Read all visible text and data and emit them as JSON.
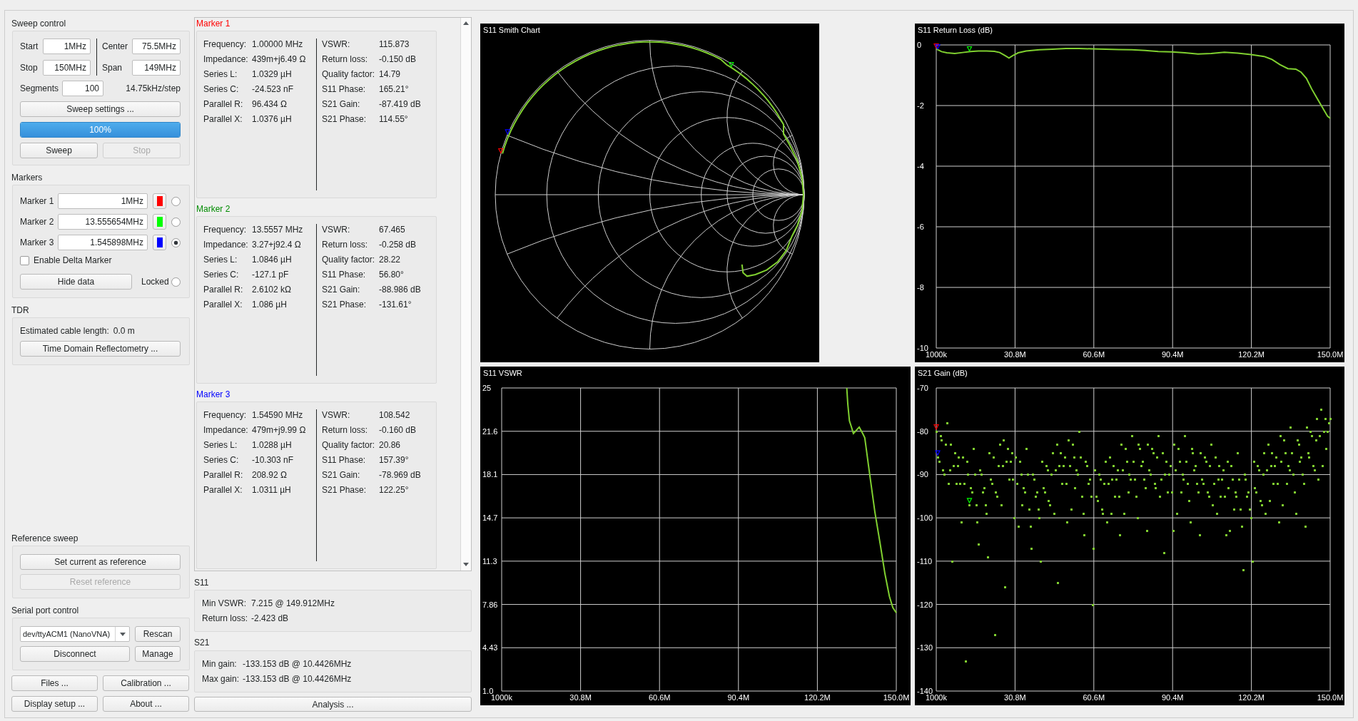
{
  "sweep_control": {
    "title": "Sweep control",
    "fields": [
      {
        "label": "Start",
        "value": "1MHz"
      },
      {
        "label": "Center",
        "value": "75.5MHz"
      },
      {
        "label": "Stop",
        "value": "150MHz"
      },
      {
        "label": "Span",
        "value": "149MHz"
      }
    ],
    "segments": {
      "label": "Segments",
      "value": "100"
    },
    "step": "14.75kHz/step",
    "settings_button": "Sweep settings ...",
    "progress": {
      "label": "100%",
      "level": 1
    },
    "buttons": [
      {
        "label": "Sweep",
        "disabled": false
      },
      {
        "label": "Stop",
        "disabled": true
      }
    ]
  },
  "markers": {
    "title": "Markers",
    "items": [
      {
        "label": "Marker 1",
        "value": "1MHz",
        "color": "#ff0000",
        "selected": false
      },
      {
        "label": "Marker 2",
        "value": "13.555654MHz",
        "color": "#00ff00",
        "selected": false
      },
      {
        "label": "Marker 3",
        "value": "1.545898MHz",
        "color": "#0000ff",
        "selected": true
      }
    ],
    "delta": {
      "label": "Enable Delta Marker",
      "checked": false
    },
    "hide_button": "Hide data",
    "locked": {
      "label": "Locked",
      "checked": false
    }
  },
  "tdr": {
    "title": "TDR",
    "estimate_label": "Estimated cable length:",
    "estimate_value": "0.0 m",
    "button": "Time Domain Reflectometry ..."
  },
  "reference_sweep": {
    "title": "Reference sweep",
    "buttons": [
      {
        "label": "Set current as reference",
        "disabled": false
      },
      {
        "label": "Reset reference",
        "disabled": true
      }
    ]
  },
  "serial_port": {
    "title": "Serial port control",
    "port": "dev/ttyACM1 (NanoVNA)",
    "buttons": [
      "Rescan",
      "Disconnect",
      "Manage"
    ]
  },
  "bottom_buttons": [
    "Files ...",
    "Calibration ...",
    "Display setup ...",
    "About ..."
  ],
  "marker_data": [
    {
      "title": "Marker 1",
      "left": [
        {
          "label": "Frequency:",
          "value": "1.00000 MHz"
        },
        {
          "label": "Impedance:",
          "value": "439m+j6.49 Ω"
        },
        {
          "label": "Series L:",
          "value": "1.0329 µH"
        },
        {
          "label": "Series C:",
          "value": "-24.523 nF"
        },
        {
          "label": "Parallel R:",
          "value": "96.434 Ω"
        },
        {
          "label": "Parallel X:",
          "value": "1.0376 µH"
        }
      ],
      "right": [
        {
          "label": "VSWR:",
          "value": "115.873"
        },
        {
          "label": "Return loss:",
          "value": "-0.150 dB"
        },
        {
          "label": "Quality factor:",
          "value": "14.79"
        },
        {
          "label": "S11 Phase:",
          "value": "165.21°"
        },
        {
          "label": "S21 Gain:",
          "value": "-87.419 dB"
        },
        {
          "label": "S21 Phase:",
          "value": "114.55°"
        }
      ]
    },
    {
      "title": "Marker 2",
      "left": [
        {
          "label": "Frequency:",
          "value": "13.5557 MHz"
        },
        {
          "label": "Impedance:",
          "value": "3.27+j92.4 Ω"
        },
        {
          "label": "Series L:",
          "value": "1.0846 µH"
        },
        {
          "label": "Series C:",
          "value": "-127.1 pF"
        },
        {
          "label": "Parallel R:",
          "value": "2.6102 kΩ"
        },
        {
          "label": "Parallel X:",
          "value": "1.086 µH"
        }
      ],
      "right": [
        {
          "label": "VSWR:",
          "value": "67.465"
        },
        {
          "label": "Return loss:",
          "value": "-0.258 dB"
        },
        {
          "label": "Quality factor:",
          "value": "28.22"
        },
        {
          "label": "S11 Phase:",
          "value": "56.80°"
        },
        {
          "label": "S21 Gain:",
          "value": "-88.986 dB"
        },
        {
          "label": "S21 Phase:",
          "value": "-131.61°"
        }
      ]
    },
    {
      "title": "Marker 3",
      "left": [
        {
          "label": "Frequency:",
          "value": "1.54590 MHz"
        },
        {
          "label": "Impedance:",
          "value": "479m+j9.99 Ω"
        },
        {
          "label": "Series L:",
          "value": "1.0288 µH"
        },
        {
          "label": "Series C:",
          "value": "-10.303 nF"
        },
        {
          "label": "Parallel R:",
          "value": "208.92 Ω"
        },
        {
          "label": "Parallel X:",
          "value": "1.0311 µH"
        }
      ],
      "right": [
        {
          "label": "VSWR:",
          "value": "108.542"
        },
        {
          "label": "Return loss:",
          "value": "-0.160 dB"
        },
        {
          "label": "Quality factor:",
          "value": "20.86"
        },
        {
          "label": "S11 Phase:",
          "value": "157.39°"
        },
        {
          "label": "S21 Gain:",
          "value": "-78.969 dB"
        },
        {
          "label": "S21 Phase:",
          "value": "122.25°"
        }
      ]
    }
  ],
  "s11": {
    "title": "S11",
    "rows": [
      {
        "label": "Min VSWR:",
        "value": "7.215 @ 149.912MHz"
      },
      {
        "label": "Return loss:",
        "value": "-2.423 dB"
      }
    ]
  },
  "s21": {
    "title": "S21",
    "rows": [
      {
        "label": "Min gain:",
        "value": "-133.153 dB @ 10.4426MHz"
      },
      {
        "label": "Max gain:",
        "value": "-133.153 dB @ 10.4426MHz"
      }
    ]
  },
  "analysis_button": "Analysis ...",
  "charts": [
    {
      "kind": "smith",
      "title": "S11 Smith Chart"
    },
    {
      "kind": "xy",
      "chart_data": {
        "type": "line",
        "title": "S11 Return Loss (dB)",
        "x": [
          1000000.0,
          3000000.0,
          5000000.0,
          8000000.0,
          11000000.0,
          14000000.0,
          17000000.0,
          20000000.0,
          23000000.0,
          25000000.0,
          27000000.0,
          28500000.0,
          30000000.0,
          32000000.0,
          35000000.0,
          40000000.0,
          45000000.0,
          50000000.0,
          55000000.0,
          60000000.0,
          65000000.0,
          70000000.0,
          75000000.0,
          80000000.0,
          85000000.0,
          90000000.0,
          95000000.0,
          100000000.0,
          105000000.0,
          110000000.0,
          115000000.0,
          120000000.0,
          125000000.0,
          128000000.0,
          131000000.0,
          134000000.0,
          137000000.0,
          139000000.0,
          141000000.0,
          143000000.0,
          145000000.0,
          147000000.0,
          149000000.0,
          150000000.0
        ],
        "series": [
          {
            "color": "#80d030",
            "values": [
              -0.13,
              -0.22,
              -0.26,
              -0.28,
              -0.25,
              -0.22,
              -0.2,
              -0.2,
              -0.21,
              -0.25,
              -0.35,
              -0.43,
              -0.35,
              -0.26,
              -0.2,
              -0.16,
              -0.14,
              -0.12,
              -0.12,
              -0.13,
              -0.14,
              -0.15,
              -0.16,
              -0.18,
              -0.22,
              -0.23,
              -0.26,
              -0.3,
              -0.28,
              -0.24,
              -0.27,
              -0.32,
              -0.38,
              -0.48,
              -0.65,
              -0.78,
              -0.8,
              -0.9,
              -1.1,
              -1.45,
              -1.75,
              -2.05,
              -2.35,
              -2.42
            ]
          }
        ],
        "xlim": [
          1000000.0,
          150000000.0
        ],
        "ylim": [
          -10,
          0
        ],
        "xticks": [
          {
            "value": 1000000.0,
            "label": "1000k"
          },
          {
            "value": 30800000.0,
            "label": "30.8M"
          },
          {
            "value": 60600000.0,
            "label": "60.6M"
          },
          {
            "value": 90400000.0,
            "label": "90.4M"
          },
          {
            "value": 120200000.0,
            "label": "120.2M"
          },
          {
            "value": 150000000.0,
            "label": "150.0M"
          }
        ],
        "yticks": [
          0,
          -2,
          -4,
          -6,
          -8,
          -10
        ],
        "grid": true
      }
    },
    {
      "kind": "xy",
      "chart_data": {
        "type": "line",
        "title": "S11 VSWR",
        "x": [
          131300000.0,
          131700000.0,
          132300000.0,
          133000000.0,
          133800000.0,
          134700000.0,
          136000000.0,
          137300000.0,
          138100000.0,
          139800000.0,
          141900000.0,
          144000000.0,
          145700000.0,
          147400000.0,
          148700000.0,
          150000000.0
        ],
        "series": [
          {
            "color": "#80d030",
            "values": [
              25,
              23.7,
              22.4,
              21.95,
              21.4,
              21.6,
              21.9,
              21.4,
              21.06,
              18.4,
              15.2,
              12.55,
              10.3,
              8.5,
              7.6,
              7.2
            ]
          }
        ],
        "xlim": [
          1000000.0,
          150000000.0
        ],
        "ylim": [
          1,
          25
        ],
        "xticks": [
          {
            "value": 1000000.0,
            "label": "1000k"
          },
          {
            "value": 30800000.0,
            "label": "30.8M"
          },
          {
            "value": 60600000.0,
            "label": "60.6M"
          },
          {
            "value": 90400000.0,
            "label": "90.4M"
          },
          {
            "value": 120200000.0,
            "label": "120.2M"
          },
          {
            "value": 150000000.0,
            "label": "150.0M"
          }
        ],
        "yticks": [
          {
            "value": 25,
            "label": "25"
          },
          {
            "value": 21.571,
            "label": "21.6"
          },
          {
            "value": 18.143,
            "label": "18.1"
          },
          {
            "value": 14.714,
            "label": "14.7"
          },
          {
            "value": 11.286,
            "label": "11.3"
          },
          {
            "value": 7.857,
            "label": "7.86"
          },
          {
            "value": 4.429,
            "label": "4.43"
          },
          {
            "value": 1,
            "label": "1.0"
          }
        ],
        "grid": true
      }
    },
    {
      "kind": "xy",
      "chart_data": {
        "type": "scatter",
        "title": "S21 Gain (dB)",
        "x": [
          1000000.0,
          2000000.0,
          3000000.0,
          4000000.0,
          5000000.0,
          6000000.0,
          7000000.0,
          8000000.0,
          9000000.0,
          10000000.0,
          11000000.0,
          12000000.0,
          13000000.0,
          14000000.0,
          15000000.0,
          16000000.0,
          17000000.0,
          18000000.0,
          19000000.0,
          20000000.0,
          21000000.0,
          22000000.0,
          23000000.0,
          24000000.0,
          25000000.0,
          26000000.0,
          27000000.0,
          28000000.0,
          29000000.0,
          30000000.0,
          31000000.0,
          32000000.0,
          33000000.0,
          34000000.0,
          35000000.0,
          36000000.0,
          37000000.0,
          38000000.0,
          39000000.0,
          40000000.0,
          41000000.0,
          42000000.0,
          43000000.0,
          44000000.0,
          45000000.0,
          46000000.0,
          47000000.0,
          48000000.0,
          49000000.0,
          50000000.0,
          51000000.0,
          52000000.0,
          53000000.0,
          54000000.0,
          55000000.0,
          56000000.0,
          57000000.0,
          58000000.0,
          59000000.0,
          60000000.0,
          61000000.0,
          62000000.0,
          63000000.0,
          64000000.0,
          65000000.0,
          66000000.0,
          67000000.0,
          68000000.0,
          69000000.0,
          70000000.0,
          71000000.0,
          72000000.0,
          73000000.0,
          74000000.0,
          75000000.0,
          76000000.0,
          77000000.0,
          78000000.0,
          79000000.0,
          80000000.0,
          81000000.0,
          82000000.0,
          83000000.0,
          84000000.0,
          85000000.0,
          86000000.0,
          87000000.0,
          88000000.0,
          89000000.0,
          90000000.0,
          91000000.0,
          92000000.0,
          93000000.0,
          94000000.0,
          95000000.0,
          96000000.0,
          97000000.0,
          98000000.0,
          99000000.0,
          100000000.0,
          101000000.0,
          102000000.0,
          103000000.0,
          104000000.0,
          105000000.0,
          106000000.0,
          107000000.0,
          108000000.0,
          109000000.0,
          110000000.0,
          111000000.0,
          112000000.0,
          113000000.0,
          114000000.0,
          115000000.0,
          116000000.0,
          117000000.0,
          118000000.0,
          119000000.0,
          120000000.0,
          121000000.0,
          122000000.0,
          123000000.0,
          124000000.0,
          125000000.0,
          126000000.0,
          127000000.0,
          128000000.0,
          129000000.0,
          130000000.0,
          131000000.0,
          132000000.0,
          133000000.0,
          134000000.0,
          135000000.0,
          136000000.0,
          137000000.0,
          138000000.0,
          139000000.0,
          140000000.0,
          141000000.0,
          142000000.0,
          143000000.0,
          144000000.0,
          145000000.0,
          146000000.0,
          147000000.0,
          148000000.0,
          149000000.0,
          150000000.0,
          1500000.0,
          2500000.0,
          3500000.0,
          4500000.0,
          5500000.0,
          6500000.0,
          7500000.0,
          8500000.0,
          9500000.0,
          10500000.0,
          11500000.0,
          12500000.0,
          13500000.0,
          14500000.0,
          15500000.0,
          16500000.0,
          17500000.0,
          18500000.0,
          19500000.0,
          20500000.0,
          21500000.0,
          22500000.0,
          23500000.0,
          24500000.0,
          25500000.0,
          26500000.0,
          27500000.0,
          28500000.0,
          29500000.0,
          30500000.0,
          31500000.0,
          32500000.0,
          33500000.0,
          34500000.0,
          35500000.0,
          36500000.0,
          37500000.0,
          38500000.0,
          39500000.0,
          40500000.0,
          41500000.0,
          42500000.0,
          43500000.0,
          44500000.0,
          45500000.0,
          46500000.0,
          47500000.0,
          48500000.0,
          49500000.0,
          50500000.0,
          51500000.0,
          52500000.0,
          53500000.0,
          54500000.0,
          55500000.0,
          56500000.0,
          57500000.0,
          58500000.0,
          59500000.0,
          60500000.0,
          61500000.0,
          62500000.0,
          63500000.0,
          64500000.0,
          65500000.0,
          66500000.0,
          67500000.0,
          68500000.0,
          69500000.0,
          70500000.0,
          71500000.0,
          72500000.0,
          73500000.0,
          74500000.0,
          75500000.0,
          76500000.0,
          77500000.0,
          78500000.0,
          79500000.0,
          80500000.0,
          81500000.0,
          82500000.0,
          83500000.0,
          84500000.0,
          85500000.0,
          86500000.0,
          87500000.0,
          88500000.0,
          89500000.0,
          90500000.0,
          91500000.0,
          92500000.0,
          93500000.0,
          94500000.0,
          95500000.0,
          96500000.0,
          97500000.0,
          98500000.0,
          99500000.0,
          100500000.0,
          101500000.0,
          102500000.0,
          103500000.0,
          104500000.0,
          105500000.0,
          106500000.0,
          107500000.0,
          108500000.0,
          109500000.0,
          110500000.0,
          111500000.0,
          112500000.0,
          113500000.0,
          114500000.0,
          115500000.0,
          116500000.0,
          117500000.0,
          118500000.0,
          119500000.0,
          120500000.0,
          121500000.0,
          122500000.0,
          123500000.0,
          124500000.0,
          125500000.0,
          126500000.0,
          127500000.0,
          128500000.0,
          129500000.0,
          130500000.0,
          131500000.0,
          132500000.0,
          133500000.0,
          134500000.0,
          135500000.0,
          136500000.0,
          137500000.0,
          138500000.0,
          139500000.0,
          140500000.0,
          141500000.0,
          142500000.0,
          143500000.0,
          144500000.0,
          145500000.0,
          146500000.0,
          147500000.0,
          148500000.0,
          149500000.0
        ],
        "series": [
          {
            "color": "#80d030",
            "values": [
              -80,
              -87,
              -82,
              -90,
              -78,
              -89,
              -110,
              -85,
              -88,
              -92,
              -86,
              -133,
              -90,
              -93,
              -84,
              -97,
              -106,
              -90,
              -93,
              -99,
              -85,
              -92,
              -127,
              -95,
              -83,
              -88,
              -116,
              -84,
              -87,
              -91,
              -86,
              -102,
              -90,
              -93,
              -84,
              -98,
              -107,
              -91,
              -94,
              -100,
              -87,
              -94,
              -89,
              -97,
              -85,
              -89,
              -115,
              -85,
              -88,
              -92,
              -82,
              -98,
              -86,
              -89,
              -80,
              -95,
              -104,
              -88,
              -91,
              -120,
              -89,
              -96,
              -91,
              -99,
              -87,
              -92,
              -99,
              -88,
              -91,
              -95,
              -83,
              -99,
              -87,
              -90,
              -81,
              -91,
              -100,
              -84,
              -87,
              -93,
              -83,
              -90,
              -85,
              -93,
              -81,
              -91,
              -108,
              -87,
              -90,
              -94,
              -83,
              -99,
              -87,
              -90,
              -81,
              -92,
              -101,
              -85,
              -88,
              -94,
              -85,
              -92,
              -87,
              -95,
              -83,
              -92,
              -99,
              -88,
              -91,
              -95,
              -87,
              -103,
              -91,
              -94,
              -85,
              -98,
              -112,
              -91,
              -94,
              -100,
              -87,
              -94,
              -89,
              -97,
              -85,
              -89,
              -96,
              -85,
              -88,
              -92,
              -81,
              -97,
              -85,
              -88,
              -79,
              -90,
              -99,
              -83,
              -86,
              -92,
              -79,
              -86,
              -81,
              -89,
              -77,
              -81,
              -88,
              -77,
              -80,
              -77,
              -86,
              -81,
              -89,
              -83,
              -92,
              -83,
              -88,
              -92,
              -86,
              -101,
              -92,
              -87,
              -97,
              -94,
              -90,
              -101,
              -89,
              -94,
              -97,
              -109,
              -91,
              -86,
              -94,
              -88,
              -97,
              -82,
              -87,
              -91,
              -85,
              -100,
              -92,
              -87,
              -97,
              -94,
              -90,
              -102,
              -90,
              -95,
              -98,
              -110,
              -93,
              -88,
              -96,
              -90,
              -99,
              -83,
              -88,
              -92,
              -86,
              -101,
              -88,
              -83,
              -93,
              -90,
              -86,
              -99,
              -87,
              -92,
              -95,
              -107,
              -95,
              -90,
              -98,
              -92,
              -101,
              -86,
              -91,
              -95,
              -89,
              -104,
              -89,
              -84,
              -94,
              -91,
              -87,
              -95,
              -83,
              -88,
              -91,
              -103,
              -89,
              -84,
              -92,
              -86,
              -95,
              -85,
              -90,
              -94,
              -88,
              -103,
              -89,
              -84,
              -94,
              -91,
              -87,
              -96,
              -84,
              -89,
              -92,
              -104,
              -91,
              -86,
              -94,
              -88,
              -97,
              -86,
              -91,
              -95,
              -89,
              -104,
              -93,
              -88,
              -98,
              -95,
              -91,
              -102,
              -90,
              -95,
              -98,
              -110,
              -93,
              -88,
              -96,
              -90,
              -99,
              -83,
              -88,
              -92,
              -86,
              -101,
              -87,
              -82,
              -92,
              -89,
              -85,
              -94,
              -82,
              -87,
              -90,
              -102,
              -85,
              -80,
              -88,
              -82,
              -91,
              -75,
              -80,
              -84,
              -78
            ]
          }
        ],
        "xlim": [
          1000000.0,
          150000000.0
        ],
        "ylim": [
          -140,
          -70
        ],
        "xticks": [
          {
            "value": 1000000.0,
            "label": "1000k"
          },
          {
            "value": 30800000.0,
            "label": "30.8M"
          },
          {
            "value": 60600000.0,
            "label": "60.6M"
          },
          {
            "value": 90400000.0,
            "label": "90.4M"
          },
          {
            "value": 120200000.0,
            "label": "120.2M"
          },
          {
            "value": 150000000.0,
            "label": "150.0M"
          }
        ],
        "yticks": [
          -70,
          -80,
          -90,
          -100,
          -110,
          -120,
          -130,
          -140
        ],
        "grid": true
      }
    }
  ]
}
